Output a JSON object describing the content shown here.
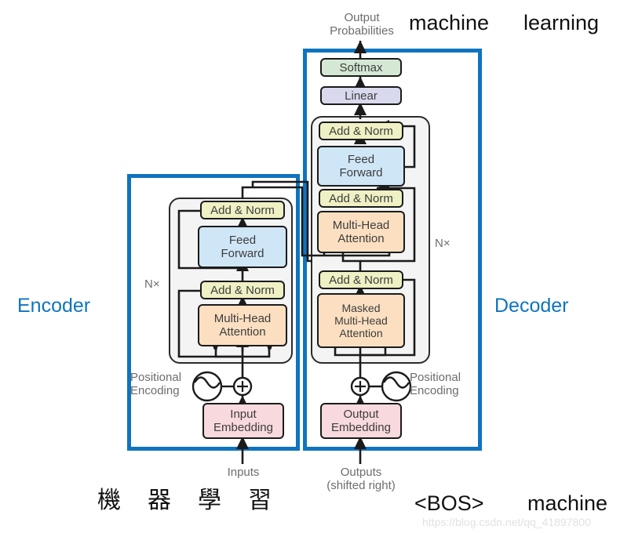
{
  "diagram": {
    "title": "Transformer encoder-decoder architecture",
    "watermark": "https://blog.csdn.net/qq_41897800"
  },
  "colors": {
    "region_border": "#0f74bf",
    "region_label": "#0f74bf",
    "stack_bg": "#f4f4f4",
    "node_border": "#1b1b1b",
    "add_norm": "#eff0c3",
    "feed_forward": "#cfe6f7",
    "attention": "#fbdfc0",
    "embedding": "#f8d9dd",
    "linear": "#d9d9ee",
    "softmax": "#d5e8d4",
    "text_gray": "#6d6d6d",
    "wire": "#1b1b1b"
  },
  "regions": {
    "encoder": {
      "label": "Encoder",
      "repeat": "N×"
    },
    "decoder": {
      "label": "Decoder",
      "repeat": "N×"
    }
  },
  "encoder_stack": {
    "nodes": [
      {
        "id": "enc-add-norm-2",
        "label": "Add & Norm",
        "fill": "#eff0c3"
      },
      {
        "id": "enc-feed-forward",
        "label": "Feed\nForward",
        "fill": "#cfe6f7"
      },
      {
        "id": "enc-add-norm-1",
        "label": "Add & Norm",
        "fill": "#eff0c3"
      },
      {
        "id": "enc-multi-head-attention",
        "label": "Multi-Head\nAttention",
        "fill": "#fbdfc0"
      }
    ]
  },
  "decoder_stack": {
    "nodes": [
      {
        "id": "dec-softmax",
        "label": "Softmax",
        "fill": "#d5e8d4"
      },
      {
        "id": "dec-linear",
        "label": "Linear",
        "fill": "#d9d9ee"
      },
      {
        "id": "dec-add-norm-3",
        "label": "Add & Norm",
        "fill": "#eff0c3"
      },
      {
        "id": "dec-feed-forward",
        "label": "Feed\nForward",
        "fill": "#cfe6f7"
      },
      {
        "id": "dec-add-norm-2",
        "label": "Add & Norm",
        "fill": "#eff0c3"
      },
      {
        "id": "dec-multi-head-attention",
        "label": "Multi-Head\nAttention",
        "fill": "#fbdfc0"
      },
      {
        "id": "dec-add-norm-1",
        "label": "Add & Norm",
        "fill": "#eff0c3"
      },
      {
        "id": "dec-masked-attention",
        "label": "Masked\nMulti-Head\nAttention",
        "fill": "#fbdfc0"
      }
    ]
  },
  "embeddings": {
    "input": {
      "label": "Input\nEmbedding",
      "fill": "#f8d9dd"
    },
    "output": {
      "label": "Output\nEmbedding",
      "fill": "#f8d9dd"
    }
  },
  "positional": {
    "left_label": "Positional\nEncoding",
    "right_label": "Positional\nEncoding"
  },
  "io_labels": {
    "output_probabilities": "Output\nProbabilities",
    "inputs": "Inputs",
    "outputs": "Outputs\n(shifted right)"
  },
  "annotations": {
    "top_right_word_1": "machine",
    "top_right_word_2": "learning",
    "source_tokens": [
      "機",
      "器",
      "學",
      "習"
    ],
    "target_token_1": "<BOS>",
    "target_token_2": "machine"
  }
}
